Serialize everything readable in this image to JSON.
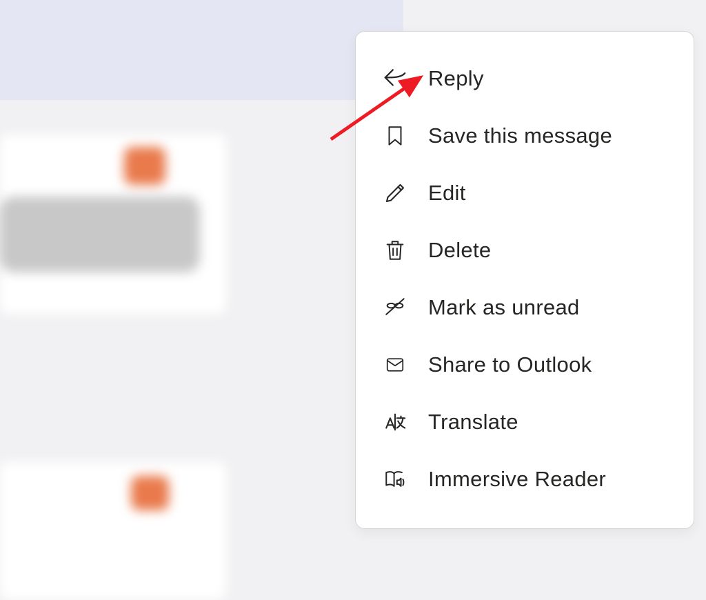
{
  "menu": {
    "items": [
      {
        "label": "Reply",
        "icon": "reply-icon"
      },
      {
        "label": "Save this message",
        "icon": "bookmark-icon"
      },
      {
        "label": "Edit",
        "icon": "pencil-icon"
      },
      {
        "label": "Delete",
        "icon": "trash-icon"
      },
      {
        "label": "Mark as unread",
        "icon": "unread-icon"
      },
      {
        "label": "Share to Outlook",
        "icon": "envelope-icon"
      },
      {
        "label": "Translate",
        "icon": "translate-icon"
      },
      {
        "label": "Immersive Reader",
        "icon": "immersive-reader-icon"
      }
    ]
  },
  "annotation": {
    "arrow_color": "#ed1c24"
  }
}
